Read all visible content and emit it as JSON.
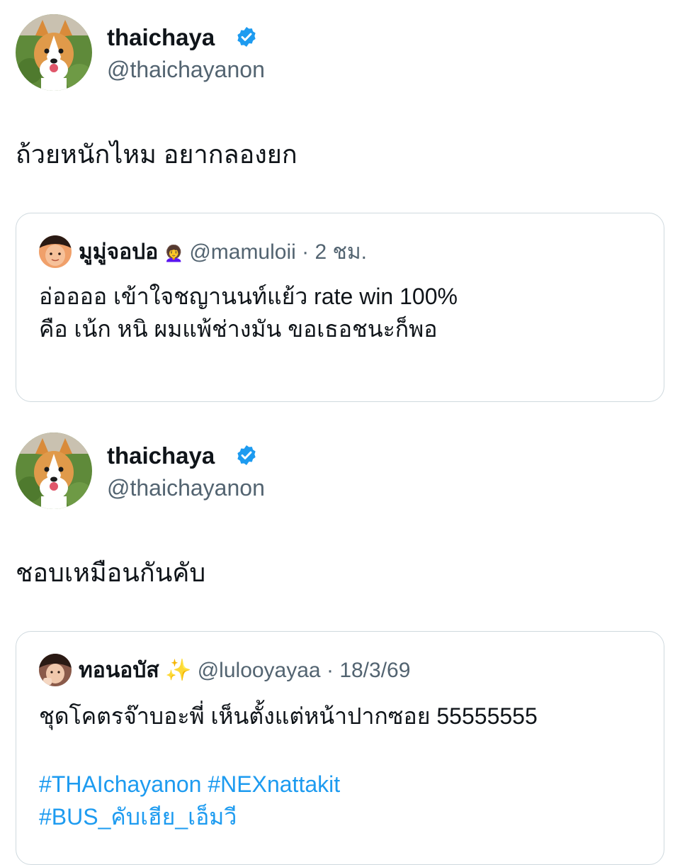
{
  "tweets": [
    {
      "author": {
        "display_name": "thaichaya",
        "handle": "@thaichayanon",
        "verified": true
      },
      "text": "ถ้วยหนักไหม อยากลองยก",
      "quote": {
        "display_name": "มูมู่จอปอ",
        "name_emoji": "👩‍🦱",
        "handle": "@mamuloii",
        "separator": "·",
        "time": "2 ชม.",
        "lines": [
          "อ่ออออ เข้าใจชญานนท์แย้ว rate win 100%",
          "คือ เน้ก หนิ ผมแพ้ช่างมัน ขอเธอชนะก็พอ"
        ]
      }
    },
    {
      "author": {
        "display_name": "thaichaya",
        "handle": "@thaichayanon",
        "verified": true
      },
      "text": "ชอบเหมือนกันคับ",
      "quote": {
        "display_name": "ทอนอบัส",
        "name_emoji": "✨",
        "handle": "@lulooyayaa",
        "separator": "·",
        "time": "18/3/69",
        "lines": [
          "ชุดโคตรจ๊าบอะพี่ เห็นตั้งแต่หน้าปากซอย 55555555"
        ],
        "hashtag_lines": [
          "#THAIchayanon #NEXnattakit",
          "#BUS_คับเฮีย_เอ็มวี"
        ]
      }
    }
  ],
  "colors": {
    "text": "#0f1419",
    "secondary": "#536471",
    "link": "#1d9bf0",
    "border": "#cfd9de",
    "verified": "#1d9bf0"
  },
  "icons": {
    "verified": "verified-badge-icon"
  }
}
